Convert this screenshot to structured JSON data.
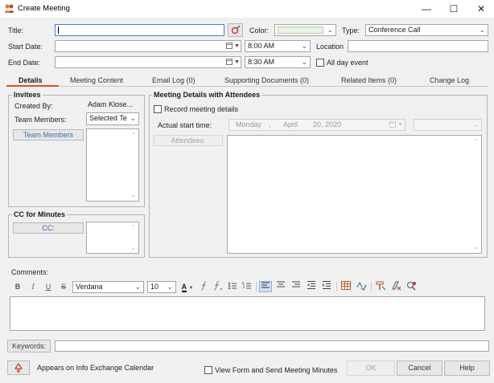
{
  "window": {
    "title": "Create Meeting",
    "minimize": "—",
    "maximize": "☐",
    "close": "✕"
  },
  "form": {
    "title_label": "Title:",
    "title_value": "",
    "color_label": "Color:",
    "color_value": "#e9f4e3",
    "type_label": "Type:",
    "type_value": "Conference Call",
    "start_date_label": "Start Date:",
    "start_date_value": "",
    "start_time_value": "8:00 AM",
    "location_label": "Location",
    "location_value": "",
    "end_date_label": "End Date:",
    "end_date_value": "",
    "end_time_value": "8:30 AM",
    "all_day_label": "All day event"
  },
  "tabs": [
    {
      "label": "Details"
    },
    {
      "label": "Meeting Content"
    },
    {
      "label": "Email Log (0)"
    },
    {
      "label": "Supporting Documents (0)"
    },
    {
      "label": "Related Items (0)"
    },
    {
      "label": "Change Log"
    }
  ],
  "invitees": {
    "legend": "Invitees",
    "created_by_label": "Created By:",
    "created_by_value": "Adam Klose...",
    "team_members_label": "Team Members:",
    "team_members_select": "Selected Te",
    "team_members_button": "Team Members"
  },
  "cc": {
    "legend": "CC for Minutes",
    "button": "CC:"
  },
  "attendees": {
    "legend": "Meeting Details with Attendees",
    "record_label": "Record meeting details",
    "actual_start_label": "Actual start time:",
    "weekday": "Monday",
    "comma": ",",
    "month": "April",
    "day_year": "20, 2020",
    "button": "Attendees:"
  },
  "comments": {
    "label": "Comments:",
    "font": "Verdana",
    "size": "10",
    "bold": "B",
    "italic": "I",
    "underline": "U",
    "strike": "S",
    "color_a": "A"
  },
  "keywords": {
    "button": "Keywords:",
    "value": ""
  },
  "footer": {
    "calendar_text": "Appears on Info Exchange Calendar",
    "send_minutes_label": "View Form and Send Meeting Minutes",
    "ok": "OK",
    "cancel": "Cancel",
    "help": "Help"
  }
}
